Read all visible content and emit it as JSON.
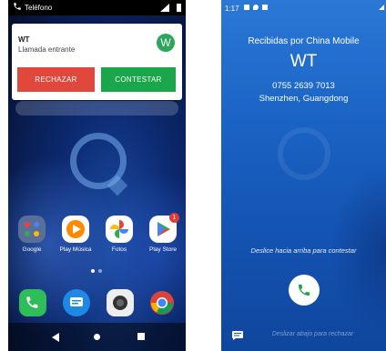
{
  "left_screen": {
    "status_bar": {
      "app_label": "Teléfono"
    },
    "notification": {
      "caller": "WT",
      "subtitle": "Llamada entrante",
      "avatar_letter": "W",
      "decline_label": "RECHAZAR",
      "accept_label": "CONTESTAR"
    },
    "apps": [
      {
        "label": "Google",
        "icon": "google-folder-icon"
      },
      {
        "label": "Play Música",
        "icon": "play-music-icon"
      },
      {
        "label": "Fotos",
        "icon": "photos-icon"
      },
      {
        "label": "Play Store",
        "icon": "play-store-icon",
        "badge": "1"
      }
    ],
    "dock": [
      "phone-icon",
      "messages-icon",
      "camera-icon",
      "chrome-icon"
    ]
  },
  "right_screen": {
    "status_bar": {
      "time": "1:17"
    },
    "received_via": "Recibidas por China Mobile",
    "caller": "WT",
    "number": "0755 2639 7013",
    "location": "Shenzhen, Guangdong",
    "swipe_up_hint": "Deslice hacia arriba para contestar",
    "swipe_down_hint": "Deslizar abajo para rechazar"
  },
  "colors": {
    "decline": "#e0483c",
    "accept": "#1aa64a",
    "avatar": "#2ba65c",
    "incoming_bg": "#1a63c4"
  }
}
